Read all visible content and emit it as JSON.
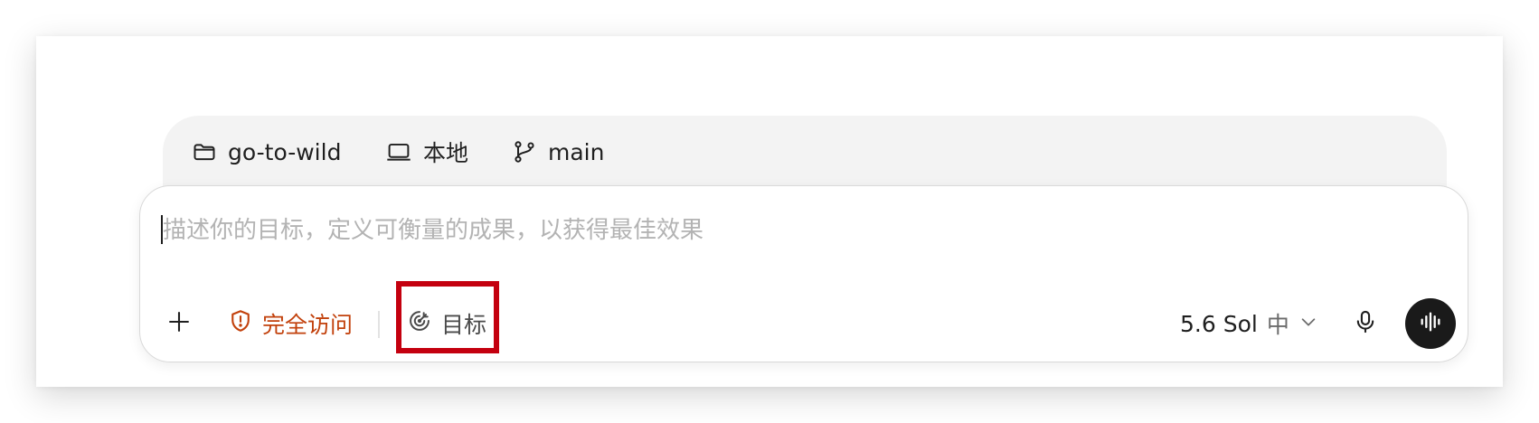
{
  "context": {
    "project": "go-to-wild",
    "environment": "本地",
    "branch": "main"
  },
  "composer": {
    "placeholder": "描述你的目标，定义可衡量的成果，以获得最佳效果",
    "value": ""
  },
  "toolbar": {
    "access_label": "完全访问",
    "goal_label": "目标",
    "model_name": "5.6 Sol",
    "reasoning_level": "中"
  },
  "icons": {
    "project": "folder-icon",
    "environment": "laptop-icon",
    "branch": "git-branch-icon",
    "add": "plus-icon",
    "access": "shield-alert-icon",
    "goal": "target-icon",
    "model_menu": "chevron-down-icon",
    "dictation": "microphone-icon",
    "voice_mode": "sound-wave-icon"
  },
  "colors": {
    "access_accent": "#c2410c",
    "highlight_box": "#c4000f",
    "voice_button": "#1a1a1a",
    "placeholder": "#b3b3b3"
  }
}
